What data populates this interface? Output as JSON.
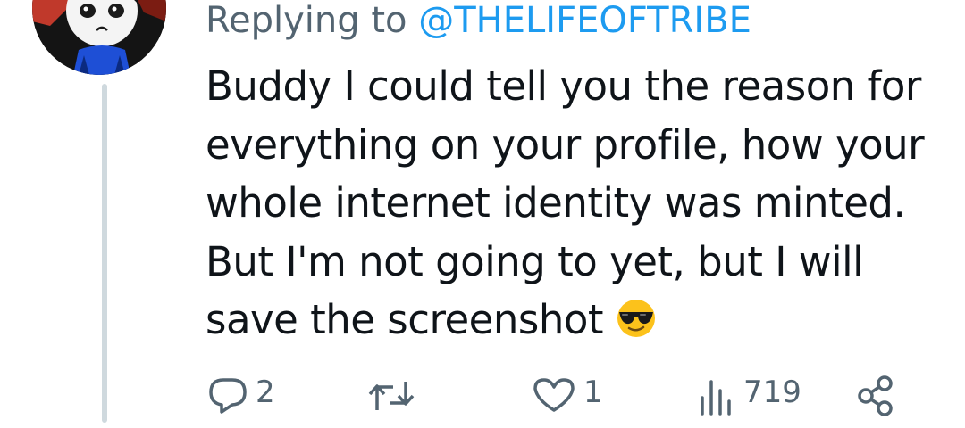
{
  "reply_context": {
    "prefix": "Replying to",
    "handle": "@THELIFEOFTRIBE"
  },
  "tweet": {
    "text": "Buddy I could tell you the reason for\neverything on your profile, how your\nwhole internet identity was minted.\nBut I'm not going to yet, but I will\nsave the screenshot",
    "emoji": "😎"
  },
  "actions": {
    "reply_count": "2",
    "retweet_count": "",
    "like_count": "1",
    "views_count": "719"
  },
  "icons": {
    "reply": "reply-icon",
    "retweet": "retweet-icon",
    "like": "heart-icon",
    "views": "views-icon",
    "share": "share-icon"
  },
  "colors": {
    "handle": "#1d9bf0",
    "text": "#0f1419",
    "secondary": "#536471",
    "thread_line": "#cfd9de"
  }
}
